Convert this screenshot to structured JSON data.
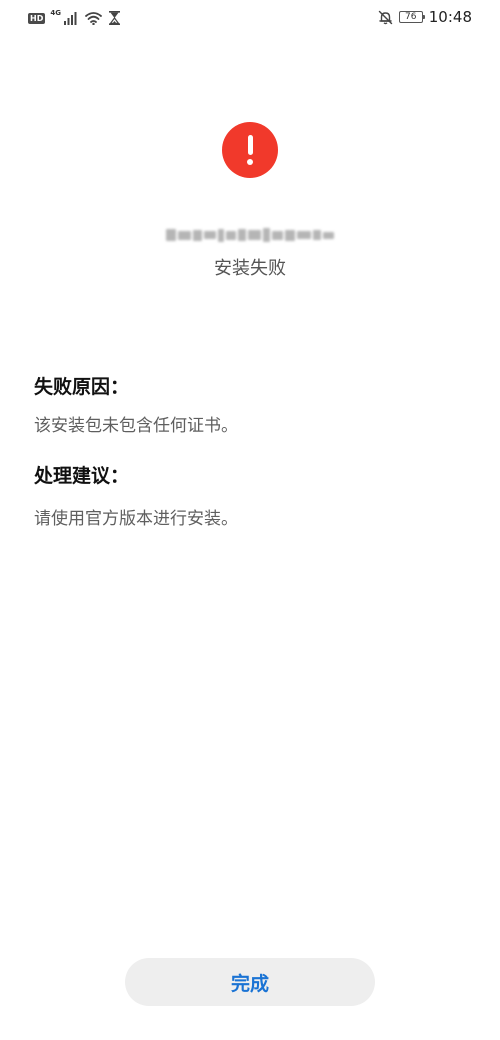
{
  "status_bar": {
    "hd_label": "HD",
    "network_label": "4G",
    "battery_level": "76",
    "time": "10:48",
    "icons": [
      "signal-icon",
      "wifi-icon",
      "hourglass-icon",
      "bell-off-icon",
      "battery-icon"
    ]
  },
  "header": {
    "app_name": "",
    "status": "安装失败",
    "error_color": "#f1392b"
  },
  "reason": {
    "title": "失败原因：",
    "text": "该安装包未包含任何证书。"
  },
  "advice": {
    "title": "处理建议：",
    "text": "请使用官方版本进行安装。"
  },
  "actions": {
    "done_label": "完成",
    "done_color": "#1a73d4"
  }
}
